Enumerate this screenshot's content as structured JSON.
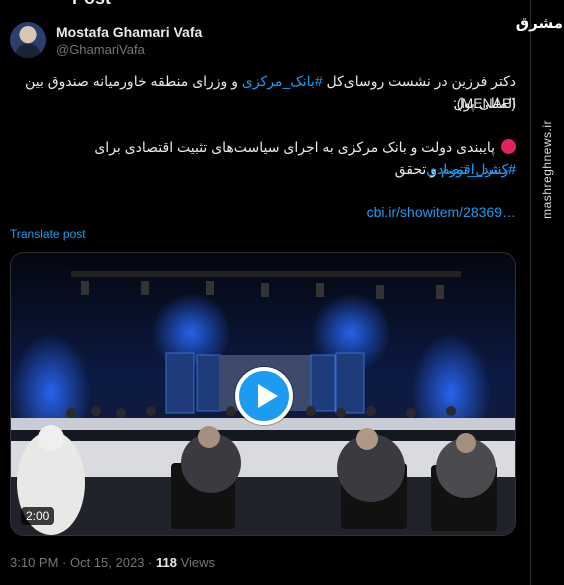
{
  "header": {
    "title": "Post"
  },
  "author": {
    "name": "Mostafa Ghamari Vafa",
    "handle": "@GhamariVafa"
  },
  "tweet": {
    "line1_a": "دکتر فرزین در نشست روسای‌کل ",
    "line1_tag": "#بانک_مرکزی",
    "line1_b": " و وزرای منطقه خاورمیانه صندوق بین المللی پول",
    "line2": "(MENAP):",
    "line3_a": "پایبندی دولت و بانک مرکزی به اجرای سیاست‌های تثبیت اقتصادی برای ",
    "line3_tag": "#کنترل_تورم",
    "line3_b": " و تحقق",
    "line4_tag": "#رشد_اقتصادی",
    "link": "cbi.ir/showitem/28369…"
  },
  "translate_label": "Translate post",
  "media": {
    "duration": "2:00"
  },
  "meta": {
    "time": "3:10 PM · Oct 15, 2023 · ",
    "views_count": "118",
    "views_label": " Views"
  },
  "watermark": {
    "logo": "مشرق",
    "site": "mashreghnews.ir"
  }
}
